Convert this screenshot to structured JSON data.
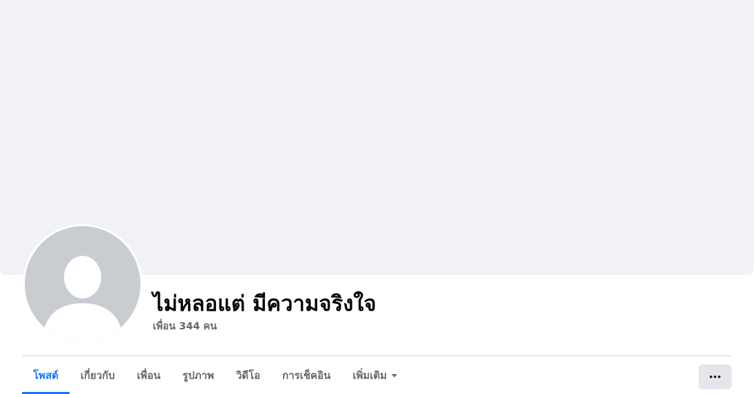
{
  "profile": {
    "name": "ไม่หลอแต่ มีความจริงใจ",
    "friends_text": "เพื่อน 344 คน"
  },
  "tabs": [
    {
      "label": "โพสต์",
      "active": true
    },
    {
      "label": "เกี่ยวกับ",
      "active": false
    },
    {
      "label": "เพื่อน",
      "active": false
    },
    {
      "label": "รูปภาพ",
      "active": false
    },
    {
      "label": "วิดีโอ",
      "active": false
    },
    {
      "label": "การเช็คอิน",
      "active": false
    },
    {
      "label": "เพิ่มเติม",
      "active": false
    }
  ],
  "icons": {
    "more_tab_caret": "chevron-down-icon",
    "more_button": "more-horizontal-icon",
    "avatar": "default-avatar-silhouette"
  },
  "colors": {
    "accent": "#1877f2",
    "cover_background": "#f0f2f5",
    "secondary_text": "#65676b",
    "primary_text": "#050505",
    "avatar_placeholder": "#c9ccd1"
  }
}
